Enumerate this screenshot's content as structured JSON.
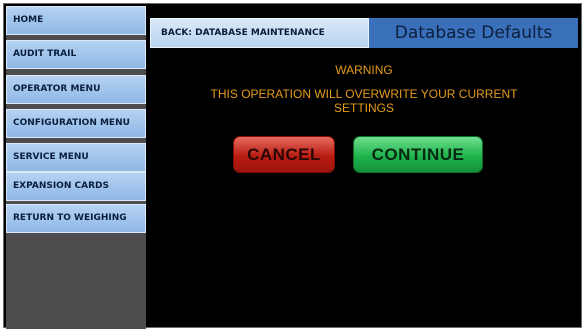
{
  "sidebar": {
    "items": [
      {
        "label": "HOME"
      },
      {
        "label": "AUDIT TRAIL"
      },
      {
        "label": "OPERATOR MENU"
      },
      {
        "label": "CONFIGURATION MENU"
      },
      {
        "label": "SERVICE MENU"
      },
      {
        "label": "EXPANSION CARDS"
      },
      {
        "label": "RETURN TO WEIGHING"
      }
    ]
  },
  "header": {
    "back_label": "BACK: DATABASE MAINTENANCE",
    "title": "Database Defaults"
  },
  "dialog": {
    "warning_title": "WARNING",
    "warning_text": "THIS OPERATION WILL OVERWRITE YOUR CURRENT SETTINGS",
    "cancel_label": "CANCEL",
    "continue_label": "CONTINUE"
  },
  "colors": {
    "background": "#000000",
    "nav_blue": "#a9cbf0",
    "title_blue": "#3a6fba",
    "warning_orange": "#e59a1f",
    "cancel_red": "#b81c12",
    "continue_green": "#1fb34c"
  }
}
